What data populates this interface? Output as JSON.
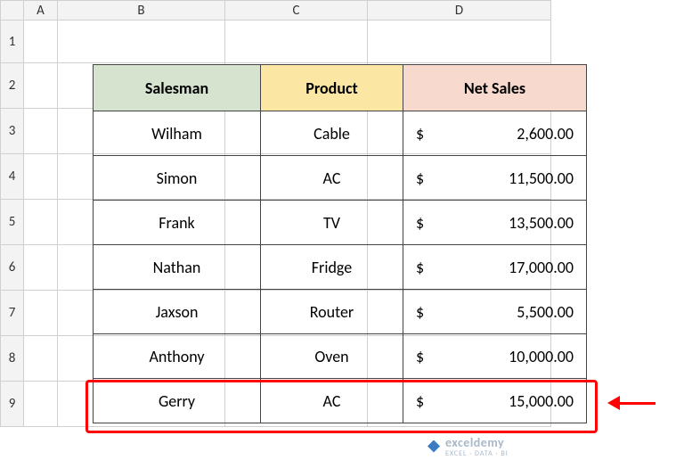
{
  "columns": {
    "corner": "",
    "A": "A",
    "B": "B",
    "C": "C",
    "D": "D"
  },
  "rows": {
    "1": "1",
    "2": "2",
    "3": "3",
    "4": "4",
    "5": "5",
    "6": "6",
    "7": "7",
    "8": "8",
    "9": "9"
  },
  "headers": {
    "salesman": "Salesman",
    "product": "Product",
    "netsales": "Net Sales"
  },
  "data": [
    {
      "salesman": "Wilham",
      "product": "Cable",
      "cur": "$",
      "amount": "2,600.00"
    },
    {
      "salesman": "Simon",
      "product": "AC",
      "cur": "$",
      "amount": "11,500.00"
    },
    {
      "salesman": "Frank",
      "product": "TV",
      "cur": "$",
      "amount": "13,500.00"
    },
    {
      "salesman": "Nathan",
      "product": "Fridge",
      "cur": "$",
      "amount": "17,000.00"
    },
    {
      "salesman": "Jaxson",
      "product": "Router",
      "cur": "$",
      "amount": "5,500.00"
    },
    {
      "salesman": "Anthony",
      "product": "Oven",
      "cur": "$",
      "amount": "10,000.00"
    },
    {
      "salesman": "Gerry",
      "product": "AC",
      "cur": "$",
      "amount": "15,000.00"
    }
  ],
  "watermark": {
    "brand": "exceldemy",
    "tag": "EXCEL · DATA · BI"
  },
  "chart_data": {
    "type": "table",
    "title": "",
    "columns": [
      "Salesman",
      "Product",
      "Net Sales"
    ],
    "rows": [
      [
        "Wilham",
        "Cable",
        2600.0
      ],
      [
        "Simon",
        "AC",
        11500.0
      ],
      [
        "Frank",
        "TV",
        13500.0
      ],
      [
        "Nathan",
        "Fridge",
        17000.0
      ],
      [
        "Jaxson",
        "Router",
        5500.0
      ],
      [
        "Anthony",
        "Oven",
        10000.0
      ],
      [
        "Gerry",
        "AC",
        15000.0
      ]
    ],
    "highlighted_row_index": 6
  }
}
